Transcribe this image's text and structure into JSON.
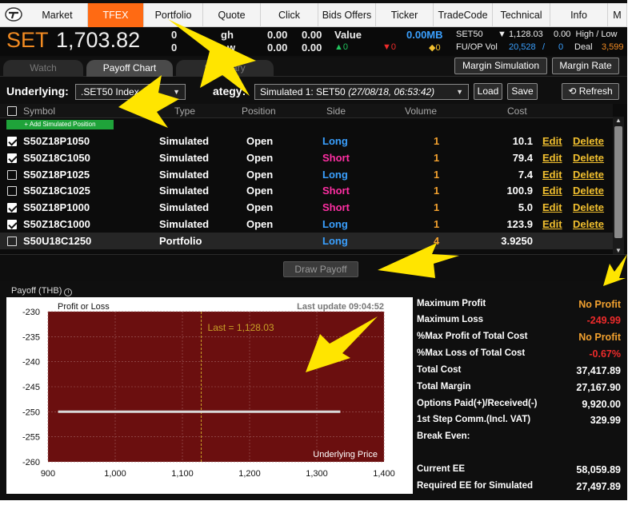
{
  "nav": {
    "tabs": [
      "Market",
      "TFEX",
      "Portfolio",
      "Quote",
      "Click",
      "Bids Offers",
      "Ticker",
      "TradeCode",
      "Technical",
      "Info",
      "M"
    ],
    "active": "TFEX"
  },
  "ticker": {
    "index_name": "SET",
    "index_value": "1,703.82",
    "c1a": "0",
    "c1b": "0",
    "high_label": "gh",
    "low_label": "w",
    "v1": "0.00",
    "v2": "0.00",
    "v3": "0.00",
    "v4": "0.00",
    "value_label": "Value",
    "value": "0.00MB",
    "up": "▲0",
    "down": "▼0",
    "unch": "◆0",
    "set50_label": "SET50",
    "set50_value": "▼ 1,128.03",
    "high_low_label": "0.00  High / Low",
    "fu_label": "FU/OP Vol",
    "fu_vol": "20,528",
    "fu_sep": "/",
    "fu_zero": "0",
    "deal_label": "Deal",
    "deal_value": "3,599"
  },
  "subtabs": [
    "Watch",
    "Payoff Chart",
    "Summary"
  ],
  "buttons": {
    "margin_sim": "Margin Simulation",
    "margin_rate": "Margin Rate",
    "load": "Load",
    "save": "Save",
    "refresh": "Refresh",
    "draw_payoff": "Draw Payoff"
  },
  "underlying": {
    "label": "Underlying:",
    "value": ".SET50 Index",
    "strategy_label": "ategy:",
    "strategy_value": "Simulated 1: SET50",
    "strategy_time": "(27/08/18, 06:53:42)"
  },
  "table": {
    "headers": [
      "Symbol",
      "Type",
      "Position",
      "Side",
      "Volume",
      "Cost"
    ],
    "add_sim": "+ Add Simulated Position",
    "edit_label": "Edit",
    "delete_label": "Delete",
    "rows": [
      {
        "checked": true,
        "symbol": "S50Z18P1050",
        "type": "Simulated",
        "position": "Open",
        "side": "Long",
        "volume": "1",
        "cost": "10.1",
        "actions": true
      },
      {
        "checked": true,
        "symbol": "S50Z18C1050",
        "type": "Simulated",
        "position": "Open",
        "side": "Short",
        "volume": "1",
        "cost": "79.4",
        "actions": true
      },
      {
        "checked": false,
        "symbol": "S50Z18P1025",
        "type": "Simulated",
        "position": "Open",
        "side": "Long",
        "volume": "1",
        "cost": "7.4",
        "actions": true
      },
      {
        "checked": false,
        "symbol": "S50Z18C1025",
        "type": "Simulated",
        "position": "Open",
        "side": "Short",
        "volume": "1",
        "cost": "100.9",
        "actions": true
      },
      {
        "checked": true,
        "symbol": "S50Z18P1000",
        "type": "Simulated",
        "position": "Open",
        "side": "Short",
        "volume": "1",
        "cost": "5.0",
        "actions": true
      },
      {
        "checked": true,
        "symbol": "S50Z18C1000",
        "type": "Simulated",
        "position": "Open",
        "side": "Long",
        "volume": "1",
        "cost": "123.9",
        "actions": true
      },
      {
        "checked": false,
        "symbol": "S50U18C1250",
        "type": "Portfolio",
        "position": "",
        "side": "Long",
        "volume": "4",
        "cost": "3.9250",
        "actions": false
      }
    ]
  },
  "payoff": {
    "title": "Payoff (THB)",
    "info_icon": "info-icon"
  },
  "chart_data": {
    "type": "line",
    "title": "Profit or Loss",
    "xlabel": "Underlying Price",
    "ylabel": "",
    "last_update": "Last update 09:04:52",
    "last_label": "Last = 1,128.03",
    "last_x": 1128.03,
    "xlim": [
      900,
      1400
    ],
    "ylim": [
      -260,
      -230
    ],
    "xticks": [
      "900",
      "1,000",
      "1,100",
      "1,200",
      "1,300",
      "1,400"
    ],
    "yticks": [
      "-230",
      "-235",
      "-240",
      "-245",
      "-250",
      "-255",
      "-260"
    ],
    "series": [
      {
        "x": [
          915,
          1335
        ],
        "y": [
          -249.99,
          -249.99
        ]
      }
    ],
    "colors": {
      "plot_bg": "#6b0f0f",
      "line": "#d9d9d9",
      "last": "#c9a227"
    }
  },
  "stats": [
    {
      "label": "Maximum Profit",
      "value": "No Profit",
      "color": "#f2a12f"
    },
    {
      "label": "Maximum Loss",
      "value": "-249.99",
      "color": "#ef2b2b"
    },
    {
      "label": "%Max Profit of Total Cost",
      "value": "No Profit",
      "color": "#f2a12f"
    },
    {
      "label": "%Max Loss of Total Cost",
      "value": "-0.67%",
      "color": "#ef2b2b"
    },
    {
      "label": "Total Cost",
      "value": "37,417.89",
      "color": "#ffffff"
    },
    {
      "label": "Total Margin",
      "value": "27,167.90",
      "color": "#ffffff"
    },
    {
      "label": "Options Paid(+)/Received(-)",
      "value": "9,920.00",
      "color": "#ffffff"
    },
    {
      "label": "1st Step Comm.(Incl. VAT)",
      "value": "329.99",
      "color": "#ffffff"
    },
    {
      "label": "Break Even:",
      "value": "",
      "color": "#ffffff"
    },
    {
      "label": "Current EE",
      "value": "58,059.89",
      "color": "#ffffff"
    },
    {
      "label": "Required EE for Simulated",
      "value": "27,497.89",
      "color": "#ffffff"
    }
  ]
}
